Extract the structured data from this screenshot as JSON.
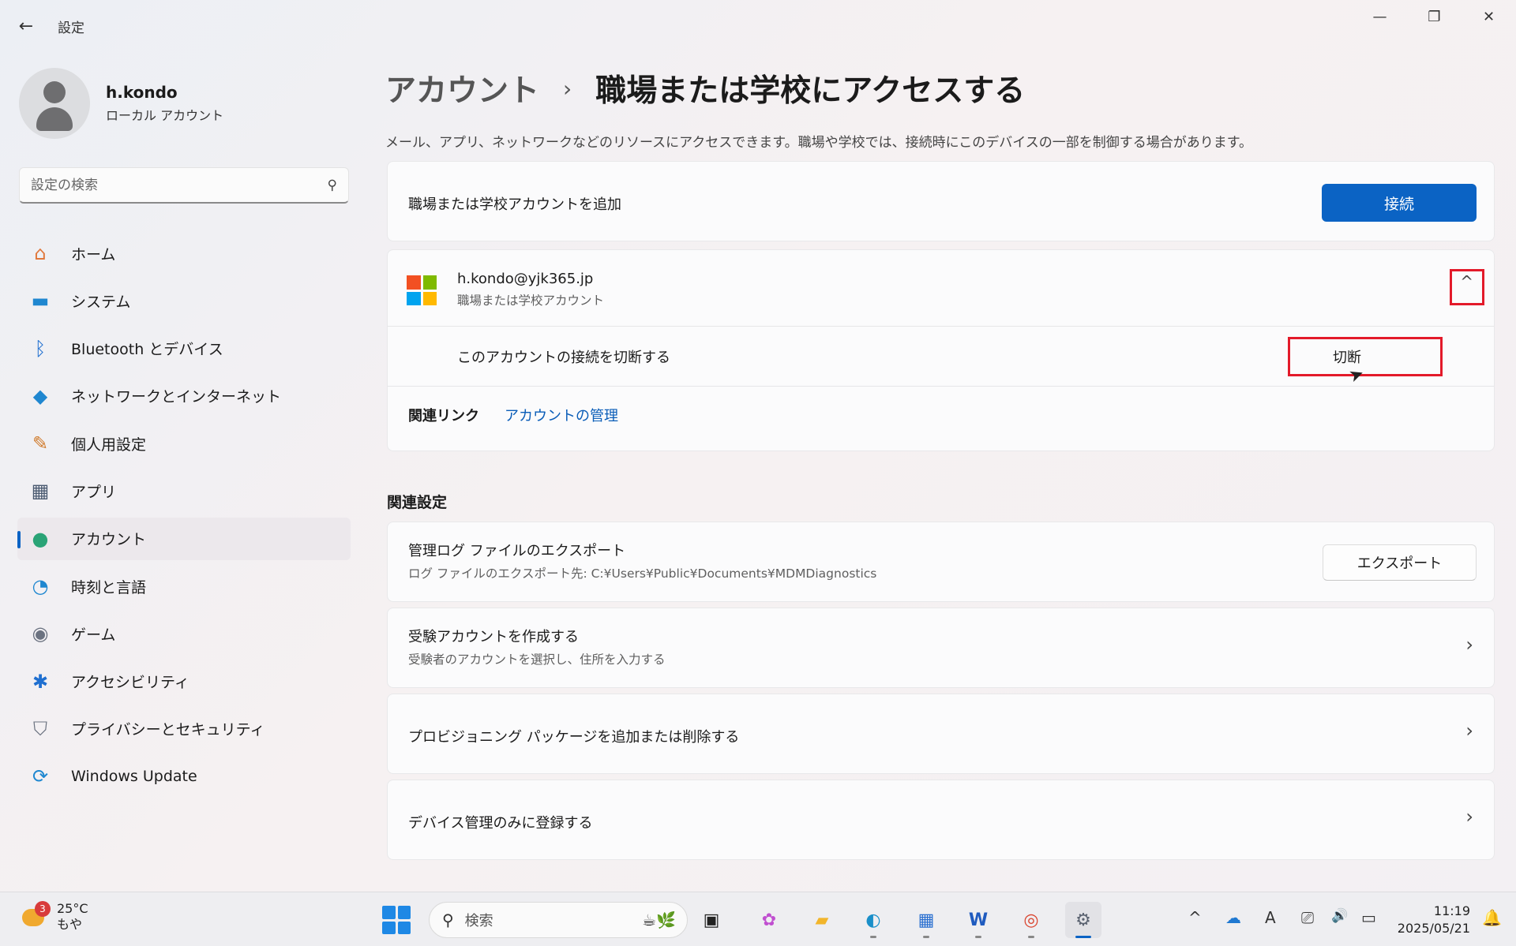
{
  "window": {
    "app_title": "設定",
    "back_glyph": "←",
    "minimize_glyph": "—",
    "maximize_glyph": "❐",
    "close_glyph": "✕"
  },
  "profile": {
    "name": "h.kondo",
    "account_type": "ローカル アカウント"
  },
  "search": {
    "placeholder": "設定の検索",
    "icon_glyph": "⚲"
  },
  "sidebar": {
    "items": [
      {
        "label": "ホーム",
        "icon": "home-icon",
        "glyph": "⌂",
        "color": "#e0773a"
      },
      {
        "label": "システム",
        "icon": "system-icon",
        "glyph": "▬",
        "color": "#1f87d0"
      },
      {
        "label": "Bluetooth とデバイス",
        "icon": "bluetooth-icon",
        "glyph": "ᛒ",
        "color": "#1f6fd0"
      },
      {
        "label": "ネットワークとインターネット",
        "icon": "wifi-icon",
        "glyph": "◆",
        "color": "#1f87d0"
      },
      {
        "label": "個人用設定",
        "icon": "brush-icon",
        "glyph": "✎",
        "color": "#d07a2a"
      },
      {
        "label": "アプリ",
        "icon": "apps-icon",
        "glyph": "▦",
        "color": "#4a5a70"
      },
      {
        "label": "アカウント",
        "icon": "account-icon",
        "glyph": "●",
        "color": "#2aa376"
      },
      {
        "label": "時刻と言語",
        "icon": "clock-globe-icon",
        "glyph": "◔",
        "color": "#1f87d0"
      },
      {
        "label": "ゲーム",
        "icon": "gamepad-icon",
        "glyph": "◉",
        "color": "#6b7280"
      },
      {
        "label": "アクセシビリティ",
        "icon": "accessibility-icon",
        "glyph": "✱",
        "color": "#1f6fd0"
      },
      {
        "label": "プライバシーとセキュリティ",
        "icon": "shield-icon",
        "glyph": "⛉",
        "color": "#6b7280"
      },
      {
        "label": "Windows Update",
        "icon": "update-icon",
        "glyph": "⟳",
        "color": "#1f87d0"
      }
    ],
    "active_index": 6
  },
  "main": {
    "breadcrumb_parent": "アカウント",
    "breadcrumb_separator": "›",
    "page_title": "職場または学校にアクセスする",
    "description": "メール、アプリ、ネットワークなどのリソースにアクセスできます。職場や学校では、接続時にこのデバイスの一部を制御する場合があります。",
    "add_account": {
      "label": "職場または学校アカウントを追加",
      "button": "接続"
    },
    "account": {
      "email": "h.kondo@yjk365.jp",
      "type": "職場または学校アカウント",
      "collapse_glyph": "^",
      "disconnect_label": "このアカウントの接続を切断する",
      "disconnect_button": "切断",
      "related_links_label": "関連リンク",
      "manage_link": "アカウントの管理"
    },
    "related_settings_title": "関連設定",
    "export": {
      "title": "管理ログ ファイルのエクスポート",
      "subtitle": "ログ ファイルのエクスポート先: C:¥Users¥Public¥Documents¥MDMDiagnostics",
      "button": "エクスポート"
    },
    "exam": {
      "title": "受験アカウントを作成する",
      "subtitle": "受験者のアカウントを選択し、住所を入力する"
    },
    "provisioning": {
      "title": "プロビジョニング パッケージを追加または削除する"
    },
    "device_mgmt": {
      "title": "デバイス管理のみに登録する"
    },
    "chevron_glyph": "›"
  },
  "taskbar": {
    "weather_badge": "3",
    "temperature": "25°C",
    "condition": "もや",
    "search_placeholder": "検索",
    "search_glyph": "⚲",
    "search_deco": "☕🌿",
    "apps": [
      {
        "name": "task-view-icon",
        "glyph": "▣",
        "color": "#222"
      },
      {
        "name": "copilot-icon",
        "glyph": "✿",
        "color": "#c04fd0"
      },
      {
        "name": "file-explorer-icon",
        "glyph": "▰",
        "color": "#f2b52b"
      },
      {
        "name": "edge-icon",
        "glyph": "◐",
        "color": "#1a8fc9"
      },
      {
        "name": "store-icon",
        "glyph": "▦",
        "color": "#2a6fd0"
      },
      {
        "name": "word-icon",
        "glyph": "W",
        "color": "#1f5bbf"
      },
      {
        "name": "chrome-icon",
        "glyph": "◎",
        "color": "#d9442f"
      },
      {
        "name": "settings-icon",
        "glyph": "⚙",
        "color": "#5a6270"
      }
    ],
    "tray": {
      "chevron_glyph": "^",
      "cloud_glyph": "☁",
      "ime_glyph": "A",
      "display_glyph": "⎚",
      "volume_glyph": "🔊",
      "battery_glyph": "▭"
    },
    "time": "11:19",
    "date": "2025/05/21",
    "notification_glyph": "🔔"
  },
  "colors": {
    "accent": "#0b63c4",
    "highlight_box": "#e31a2a"
  }
}
